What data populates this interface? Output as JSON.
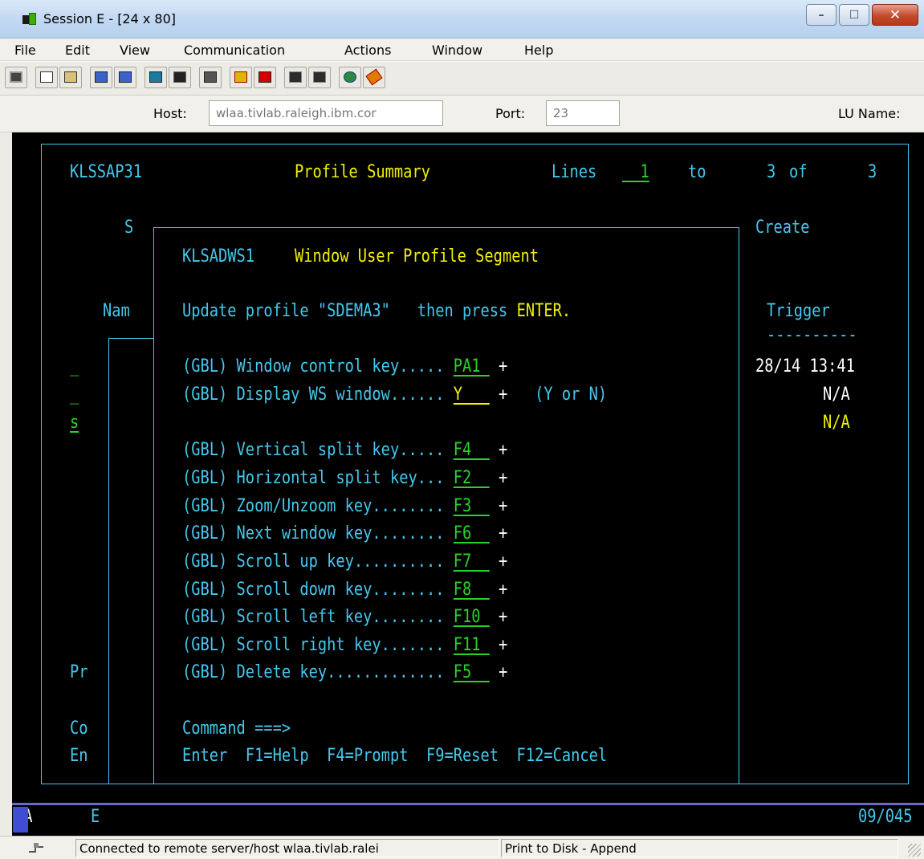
{
  "window": {
    "title": "Session E - [24 x 80]",
    "icon": "host-session-icon",
    "controls": {
      "minimize": "–",
      "maximize": "☐",
      "close": "✕"
    }
  },
  "menu": [
    "File",
    "Edit",
    "View",
    "Communication",
    "Actions",
    "Window",
    "Help"
  ],
  "toolbar": {
    "icons": [
      "print-screen-icon",
      "copy-icon",
      "paste-icon",
      "send-file-icon",
      "receive-file-icon",
      "display-setup-icon",
      "keyboard-setup-icon",
      "macro-icon",
      "record-macro-icon",
      "stop-macro-icon",
      "play-macro-icon",
      "playback-icon",
      "host-globe-icon",
      "help-pencil-icon"
    ]
  },
  "hostbar": {
    "host_label": "Host:",
    "host_value": "wlaa.tivlab.raleigh.ibm.cor",
    "port_label": "Port:",
    "port_value": "23",
    "lu_label": "LU Name:"
  },
  "terminal": {
    "header": {
      "panel_id": "KLSSAP31",
      "title": "Profile Summary",
      "lines_label": "Lines",
      "lines_from": "1",
      "to_label": "to",
      "lines_to": "3",
      "of_label": "of",
      "lines_total": "3"
    },
    "background": {
      "s_label": "S",
      "name_label": "Nam",
      "create_label": "Create",
      "trigger_label": "Trigger",
      "trigger_rule": "----------",
      "row1_sel": "_",
      "row2_sel": "_",
      "row3_sel": "s",
      "row1_value": "28/14 13:41",
      "row2_value": "N/A",
      "row3_value": "N/A",
      "pr_label": "Pr",
      "co_label": "Co",
      "en_label": "En"
    },
    "popup": {
      "panel_id": "KLSADWS1",
      "title": "Window User Profile Segment",
      "instruction_prefix": "Update profile \"SDEMA3\"   then press",
      "instruction_key": "ENTER.",
      "fields": [
        {
          "label": "(GBL) Window control key..... ",
          "value": "PA1 ",
          "prompt": "+"
        },
        {
          "label": "(GBL) Display WS window...... ",
          "value": "Y   ",
          "prompt": "+",
          "hint": "(Y or N)"
        },
        {
          "label": "(GBL) Vertical split key..... ",
          "value": "F4  ",
          "prompt": "+"
        },
        {
          "label": "(GBL) Horizontal split key... ",
          "value": "F2  ",
          "prompt": "+"
        },
        {
          "label": "(GBL) Zoom/Unzoom key........ ",
          "value": "F3  ",
          "prompt": "+"
        },
        {
          "label": "(GBL) Next window key........ ",
          "value": "F6  ",
          "prompt": "+"
        },
        {
          "label": "(GBL) Scroll up key.......... ",
          "value": "F7  ",
          "prompt": "+"
        },
        {
          "label": "(GBL) Scroll down key........ ",
          "value": "F8  ",
          "prompt": "+"
        },
        {
          "label": "(GBL) Scroll left key........ ",
          "value": "F10 ",
          "prompt": "+"
        },
        {
          "label": "(GBL) Scroll right key....... ",
          "value": "F11 ",
          "prompt": "+"
        },
        {
          "label": "(GBL) Delete key............. ",
          "value": "F5  ",
          "prompt": "+"
        }
      ],
      "command_label": "Command ===>",
      "pf_keys": "Enter  F1=Help  F4=Prompt  F9=Reset  F12=Cancel"
    },
    "oia": {
      "left": "MA",
      "session": "E",
      "cursor": "09/045"
    }
  },
  "statusbar": {
    "connection": "Connected to remote server/host wlaa.tivlab.ralei",
    "print": "Print to Disk - Append"
  },
  "colors": {
    "cyan": "#45c8ed",
    "yellow": "#f0f000",
    "green": "#29d22a",
    "terminal_bg": "#000000"
  }
}
